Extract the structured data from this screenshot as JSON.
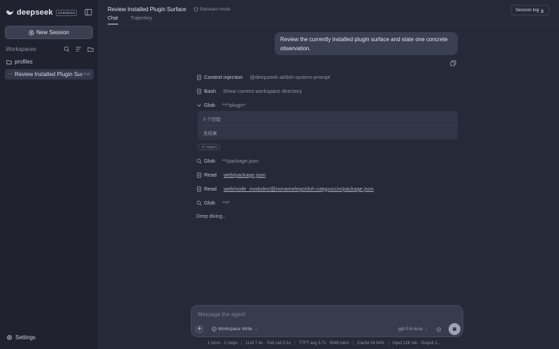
{
  "colors": {
    "background": "#262a38",
    "sidebar": "#20232f",
    "accent": "#9ea3b4"
  },
  "sidebar": {
    "brand_name": "deepseek",
    "brand_badge": "HARNESS",
    "new_session_label": "New Session",
    "workspaces_label": "Workspaces",
    "folder_label": "profiles",
    "session_item": {
      "label": "Review Installed Plugin Surface",
      "time": "now"
    },
    "settings_label": "Settings"
  },
  "header": {
    "title": "Review Installed Plugin Surface",
    "mode": "Standard mode",
    "tabs": [
      {
        "label": "Chat",
        "active": true
      },
      {
        "label": "Trajectory",
        "active": false
      }
    ],
    "session_log_label": "Session log"
  },
  "chat": {
    "user_message": "Review the currently installed plugin surface and state one concrete observation.",
    "steps": [
      {
        "icon": "document-icon",
        "name": "Context injection",
        "arg": "@deepseek-ai/dsh-system-prompt"
      },
      {
        "icon": "document-icon",
        "name": "Bash",
        "arg": "Show current workspace directory"
      },
      {
        "icon": "chevron-down-icon",
        "name": "Glob",
        "arg": "**/*plugin*"
      },
      {
        "icon": "search-icon",
        "name": "Glob",
        "arg": "**/package.json"
      },
      {
        "icon": "document-icon",
        "name": "Read",
        "arg": "web/package.json"
      },
      {
        "icon": "document-icon",
        "name": "Read",
        "arg": "web/node_modules/@nonamelego/dsh-catppuccin/package.json"
      },
      {
        "icon": "search-icon",
        "name": "Glob",
        "arg": "**/*"
      }
    ],
    "glob_result": {
      "row1": "0 个匹配",
      "row2": "无结果"
    },
    "inspect_label": "</> inspect",
    "thinking_text": "Deep diving..."
  },
  "composer": {
    "placeholder": "Message the agent",
    "workspace_mode": "Workspace Write",
    "model": "gpt-5.6-luna"
  },
  "status": {
    "items": [
      "1 turns · 2 steps",
      "LLM 7.4s · Tool call 0.1s",
      "TTFT avg 3.7s · 9048 tok/s",
      "Cache hit 94%",
      "Input 12K tok · Output 2..."
    ]
  }
}
